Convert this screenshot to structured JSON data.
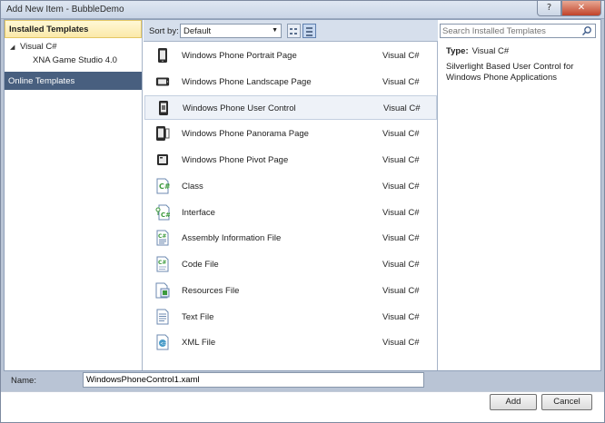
{
  "window": {
    "title": "Add New Item - BubbleDemo",
    "help_label": "?",
    "close_label": "✕"
  },
  "left": {
    "header": "Installed Templates",
    "tree": [
      {
        "label": "Visual C#",
        "expander": "◢"
      },
      {
        "label": "XNA Game Studio 4.0"
      }
    ],
    "online": "Online Templates"
  },
  "toolbar": {
    "sort_label": "Sort by:",
    "sort_value": "Default",
    "sort_arrow": "▼"
  },
  "templates": [
    {
      "name": "Windows Phone Portrait Page",
      "type": "Visual C#",
      "icon": "phone-portrait-icon"
    },
    {
      "name": "Windows Phone Landscape Page",
      "type": "Visual C#",
      "icon": "phone-landscape-icon"
    },
    {
      "name": "Windows Phone User Control",
      "type": "Visual C#",
      "icon": "phone-user-control-icon",
      "selected": true
    },
    {
      "name": "Windows Phone Panorama Page",
      "type": "Visual C#",
      "icon": "phone-panorama-icon"
    },
    {
      "name": "Windows Phone Pivot Page",
      "type": "Visual C#",
      "icon": "phone-pivot-icon"
    },
    {
      "name": "Class",
      "type": "Visual C#",
      "icon": "csharp-class-icon"
    },
    {
      "name": "Interface",
      "type": "Visual C#",
      "icon": "csharp-interface-icon"
    },
    {
      "name": "Assembly Information File",
      "type": "Visual C#",
      "icon": "assembly-info-icon"
    },
    {
      "name": "Code File",
      "type": "Visual C#",
      "icon": "code-file-icon"
    },
    {
      "name": "Resources File",
      "type": "Visual C#",
      "icon": "resources-file-icon"
    },
    {
      "name": "Text File",
      "type": "Visual C#",
      "icon": "text-file-icon"
    },
    {
      "name": "XML File",
      "type": "Visual C#",
      "icon": "xml-file-icon"
    }
  ],
  "right": {
    "search_placeholder": "Search Installed Templates",
    "type_label": "Type:",
    "type_value": "Visual C#",
    "description": "Silverlight Based User Control for Windows Phone Applications"
  },
  "bottom": {
    "name_label": "Name:",
    "name_value": "WindowsPhoneControl1.xaml",
    "add_label": "Add",
    "cancel_label": "Cancel"
  },
  "colors": {
    "selected_nav": "#485f7f",
    "header_gold": "#fbe9a9",
    "csharp_green": "#3c9a3c",
    "toolbar_bg": "#d6dfec"
  }
}
